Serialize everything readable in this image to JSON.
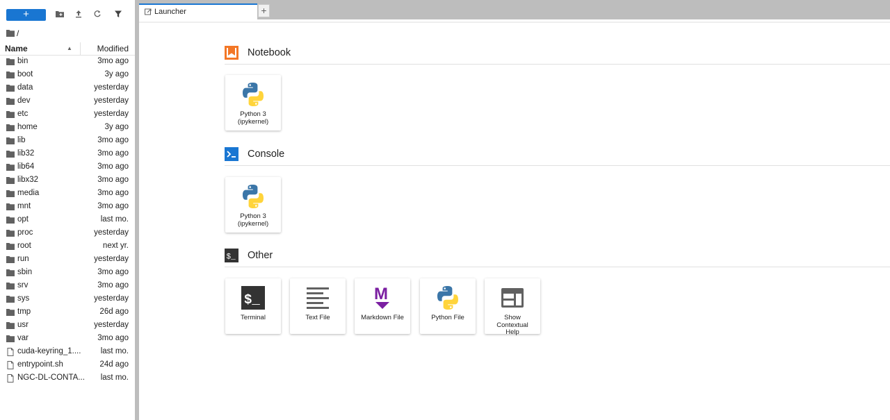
{
  "sidebar": {
    "toolbar": {
      "new_label": "+",
      "icons": [
        "new-folder-icon",
        "upload-icon",
        "refresh-icon",
        "filter-icon"
      ]
    },
    "breadcrumb": "/",
    "header": {
      "name": "Name",
      "sort_indicator": "▲",
      "modified": "Modified"
    },
    "files": [
      {
        "name": "bin",
        "modified": "3mo ago",
        "type": "folder"
      },
      {
        "name": "boot",
        "modified": "3y ago",
        "type": "folder"
      },
      {
        "name": "data",
        "modified": "yesterday",
        "type": "folder"
      },
      {
        "name": "dev",
        "modified": "yesterday",
        "type": "folder"
      },
      {
        "name": "etc",
        "modified": "yesterday",
        "type": "folder"
      },
      {
        "name": "home",
        "modified": "3y ago",
        "type": "folder"
      },
      {
        "name": "lib",
        "modified": "3mo ago",
        "type": "folder"
      },
      {
        "name": "lib32",
        "modified": "3mo ago",
        "type": "folder"
      },
      {
        "name": "lib64",
        "modified": "3mo ago",
        "type": "folder"
      },
      {
        "name": "libx32",
        "modified": "3mo ago",
        "type": "folder"
      },
      {
        "name": "media",
        "modified": "3mo ago",
        "type": "folder"
      },
      {
        "name": "mnt",
        "modified": "3mo ago",
        "type": "folder"
      },
      {
        "name": "opt",
        "modified": "last mo.",
        "type": "folder"
      },
      {
        "name": "proc",
        "modified": "yesterday",
        "type": "folder"
      },
      {
        "name": "root",
        "modified": "next yr.",
        "type": "folder"
      },
      {
        "name": "run",
        "modified": "yesterday",
        "type": "folder"
      },
      {
        "name": "sbin",
        "modified": "3mo ago",
        "type": "folder"
      },
      {
        "name": "srv",
        "modified": "3mo ago",
        "type": "folder"
      },
      {
        "name": "sys",
        "modified": "yesterday",
        "type": "folder"
      },
      {
        "name": "tmp",
        "modified": "26d ago",
        "type": "folder"
      },
      {
        "name": "usr",
        "modified": "yesterday",
        "type": "folder"
      },
      {
        "name": "var",
        "modified": "3mo ago",
        "type": "folder"
      },
      {
        "name": "cuda-keyring_1....",
        "modified": "last mo.",
        "type": "file"
      },
      {
        "name": "entrypoint.sh",
        "modified": "24d ago",
        "type": "file"
      },
      {
        "name": "NGC-DL-CONTA...",
        "modified": "last mo.",
        "type": "file"
      }
    ]
  },
  "tabs": {
    "active_label": "Launcher",
    "add_label": "+"
  },
  "launcher": {
    "sections": [
      {
        "title": "Notebook",
        "icon": "notebook-icon",
        "cards": [
          {
            "line1": "Python 3",
            "line2": "(ipykernel)",
            "icon": "python-logo-icon"
          }
        ]
      },
      {
        "title": "Console",
        "icon": "console-icon",
        "cards": [
          {
            "line1": "Python 3",
            "line2": "(ipykernel)",
            "icon": "python-logo-icon"
          }
        ]
      },
      {
        "title": "Other",
        "icon": "other-terminal-icon",
        "cards": [
          {
            "line1": "Terminal",
            "icon": "terminal-icon"
          },
          {
            "line1": "Text File",
            "icon": "text-file-icon"
          },
          {
            "line1": "Markdown File",
            "icon": "markdown-icon"
          },
          {
            "line1": "Python File",
            "icon": "python-logo-icon"
          },
          {
            "line1": "Show",
            "line2": "Contextual",
            "line3": "Help",
            "icon": "contextual-help-icon"
          }
        ]
      }
    ]
  },
  "colors": {
    "accent": "#1976d2",
    "notebook_orange": "#f37726",
    "markdown_purple": "#7b1fa2",
    "python_blue": "#3b76a8",
    "python_yellow": "#ffd43b"
  }
}
